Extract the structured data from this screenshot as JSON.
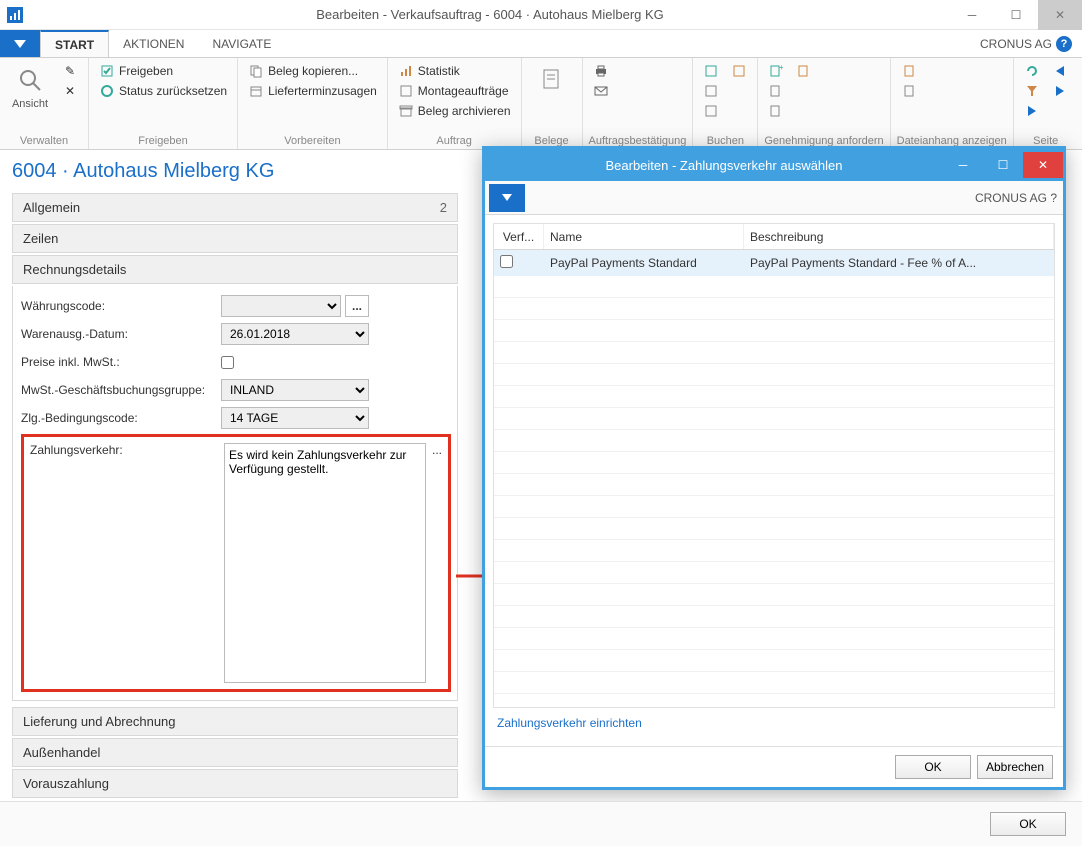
{
  "window": {
    "title": "Bearbeiten - Verkaufsauftrag - 6004 · Autohaus Mielberg KG"
  },
  "ribbonTabs": {
    "start": "START",
    "aktionen": "AKTIONEN",
    "navigate": "NAVIGATE"
  },
  "company": "CRONUS AG",
  "ribbon": {
    "verwalten": {
      "label": "Verwalten",
      "ansicht": "Ansicht"
    },
    "freigeben": {
      "label": "Freigeben",
      "freigeben": "Freigeben",
      "status": "Status zurücksetzen"
    },
    "vorbereiten": {
      "label": "Vorbereiten",
      "kopieren": "Beleg kopieren...",
      "liefer": "Lieferterminzusagen"
    },
    "auftrag": {
      "label": "Auftrag",
      "statistik": "Statistik",
      "montage": "Montageaufträge",
      "archiv": "Beleg archivieren"
    },
    "belege": {
      "label": "Belege"
    },
    "auftragsbest": {
      "label": "Auftragsbestätigung"
    },
    "buchen": {
      "label": "Buchen"
    },
    "genehmigung": {
      "label": "Genehmigung anfordern"
    },
    "datei": {
      "label": "Dateianhang anzeigen"
    },
    "seite": {
      "label": "Seite"
    }
  },
  "page": {
    "heading": "6004 · Autohaus Mielberg KG",
    "tabs": {
      "allgemein": "Allgemein",
      "allgemein_badge": "2",
      "zeilen": "Zeilen",
      "rechnungsdetails": "Rechnungsdetails",
      "lieferung": "Lieferung und Abrechnung",
      "aussenhandel": "Außenhandel",
      "vorauszahlung": "Vorauszahlung"
    },
    "fields": {
      "waehrungscode_lbl": "Währungscode:",
      "waehrungscode_val": "",
      "warenausg_lbl": "Warenausg.-Datum:",
      "warenausg_val": "26.01.2018",
      "preise_lbl": "Preise inkl. MwSt.:",
      "preise_val": false,
      "mwst_lbl": "MwSt.-Geschäftsbuchungsgruppe:",
      "mwst_val": "INLAND",
      "zlg_lbl": "Zlg.-Bedingungscode:",
      "zlg_val": "14 TAGE",
      "zahlung_lbl": "Zahlungsverkehr:",
      "zahlung_val": "Es wird kein Zahlungsverkehr zur Verfügung gestellt."
    }
  },
  "dialog": {
    "title": "Bearbeiten - Zahlungsverkehr auswählen",
    "company": "CRONUS AG",
    "columns": {
      "verf": "Verf...",
      "name": "Name",
      "beschr": "Beschreibung"
    },
    "row": {
      "name": "PayPal Payments Standard",
      "beschr": "PayPal Payments Standard - Fee % of A..."
    },
    "link": "Zahlungsverkehr einrichten",
    "ok": "OK",
    "cancel": "Abbrechen"
  },
  "footer": {
    "ok": "OK"
  }
}
